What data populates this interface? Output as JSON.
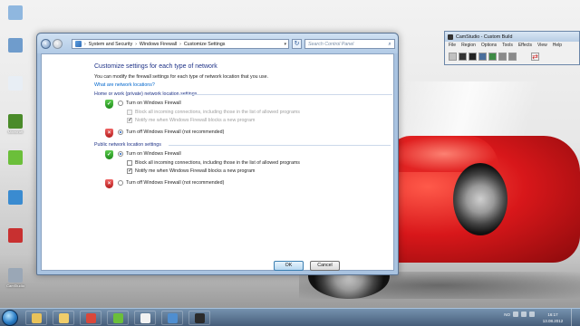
{
  "control_panel": {
    "breadcrumb": [
      "System and Security",
      "Windows Firewall",
      "Customize Settings"
    ],
    "search_placeholder": "Search Control Panel",
    "heading": "Customize settings for each type of network",
    "description": "You can modify the firewall settings for each type of network location that you use.",
    "link": "What are network locations?",
    "home_group": {
      "title": "Home or work (private) network location settings",
      "turn_on": "Turn on Windows Firewall",
      "block_all": "Block all incoming connections, including those in the list of allowed programs",
      "notify": "Notify me when Windows Firewall blocks a new program",
      "turn_off": "Turn off Windows Firewall (not recommended)",
      "selected": "turn_off",
      "block_all_checked": false,
      "notify_checked": true
    },
    "public_group": {
      "title": "Public network location settings",
      "turn_on": "Turn on Windows Firewall",
      "block_all": "Block all incoming connections, including those in the list of allowed programs",
      "notify": "Notify me when Windows Firewall blocks a new program",
      "turn_off": "Turn off Windows Firewall (not recommended)",
      "selected": "turn_on",
      "block_all_checked": false,
      "notify_checked": true
    },
    "ok_label": "OK",
    "cancel_label": "Cancel"
  },
  "camstudio": {
    "title": "CamStudio - Custom Build",
    "menu": [
      "File",
      "Region",
      "Options",
      "Tools",
      "Effects",
      "View",
      "Help"
    ]
  },
  "desktop_icons": [
    {
      "label": "",
      "icon": "computer-icon",
      "color": "#8fb7df"
    },
    {
      "label": "",
      "icon": "network-icon",
      "color": "#6f9ccc"
    },
    {
      "label": "",
      "icon": "document-icon",
      "color": "#e8eef5"
    },
    {
      "label": "Minecraft",
      "icon": "minecraft-icon",
      "color": "#4a8b2a"
    },
    {
      "label": "",
      "icon": "spotify-icon",
      "color": "#6bbf3a"
    },
    {
      "label": "",
      "icon": "app-icon",
      "color": "#3a8bd0"
    },
    {
      "label": "",
      "icon": "app-icon",
      "color": "#c83030"
    },
    {
      "label": "CamStudio",
      "icon": "camstudio-icon",
      "color": "#9aa7b6"
    }
  ],
  "taskbar": {
    "items": [
      {
        "icon": "explorer-icon",
        "color": "#e8c25a"
      },
      {
        "icon": "folder-icon",
        "color": "#f0cd6a"
      },
      {
        "icon": "chrome-icon",
        "color": "#d9473a"
      },
      {
        "icon": "spotify-icon",
        "color": "#6bbf3a"
      },
      {
        "icon": "chat-icon",
        "color": "#f2f2f2"
      },
      {
        "icon": "control-panel-icon",
        "color": "#4f8ed0"
      },
      {
        "icon": "camstudio-icon",
        "color": "#2b2b2b"
      }
    ],
    "tray_lang": "NO",
    "clock_time": "16:17",
    "clock_date": "13.08.2012"
  }
}
